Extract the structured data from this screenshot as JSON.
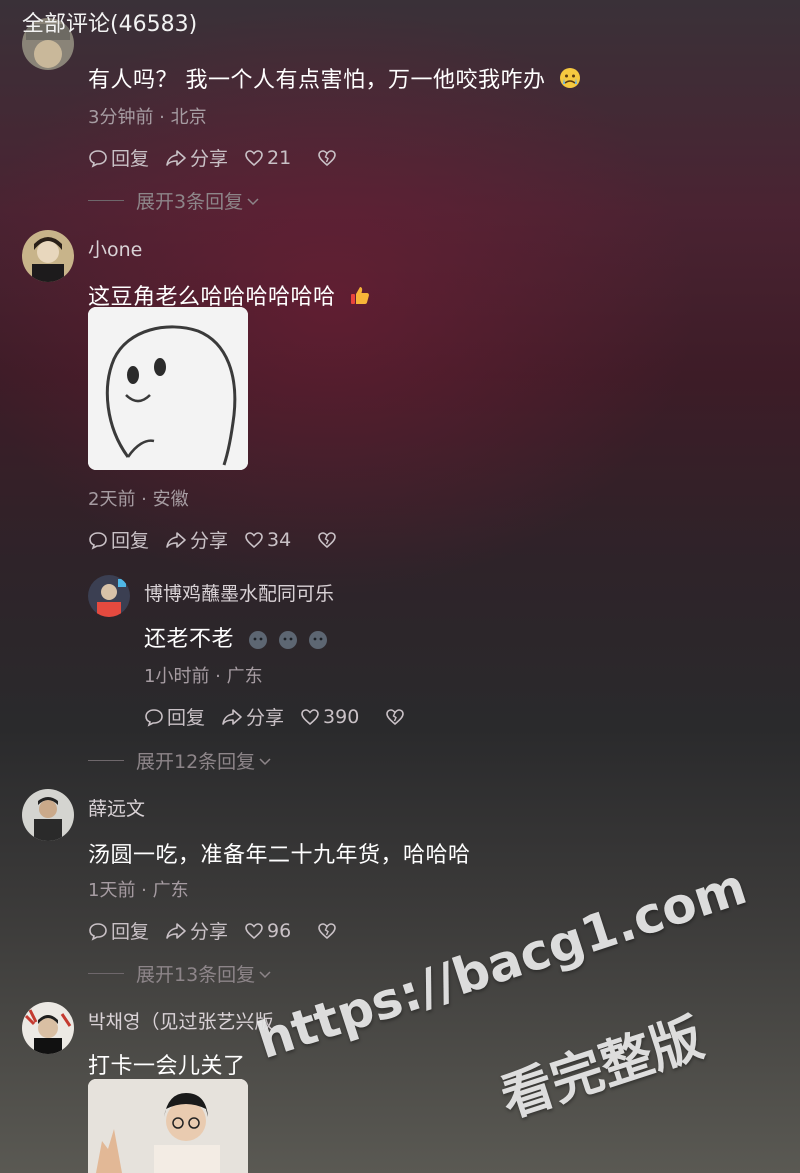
{
  "header": {
    "title": "全部评论(46583)"
  },
  "comments": [
    {
      "text": "有人吗？ 我一个人有点害怕，万一他咬我咋办",
      "emoji": "crying-face",
      "meta": "3分钟前 · 北京",
      "reply": "回复",
      "share": "分享",
      "likes": "21",
      "expand": "展开3条回复"
    },
    {
      "name": "小one",
      "text": "这豆角老么哈哈哈哈哈哈",
      "emoji": "thumbs-up",
      "meta": "2天前 · 安徽",
      "reply": "回复",
      "share": "分享",
      "likes": "34"
    },
    {
      "name": "博博鸡蘸墨水配同可乐",
      "text": "还老不老",
      "emoji": "round-face x3",
      "meta": "1小时前 · 广东",
      "reply": "回复",
      "share": "分享",
      "likes": "390",
      "expand": "展开12条回复"
    },
    {
      "name": "薛远文",
      "text": "汤圆一吃，准备年二十九年货，哈哈哈",
      "meta": "1天前 · 广东",
      "reply": "回复",
      "share": "分享",
      "likes": "96",
      "expand": "展开13条回复"
    },
    {
      "name": "박채영（见过张艺兴版",
      "text": "打卡一会儿关了"
    }
  ],
  "watermark": {
    "url": "https://bacg1.com",
    "caption": "看完整版"
  },
  "colors": {
    "background_top": "#3a3138",
    "background_mid": "#3d1c27",
    "background_bottom": "#5a5953",
    "meta_text": "#a69ca2"
  }
}
